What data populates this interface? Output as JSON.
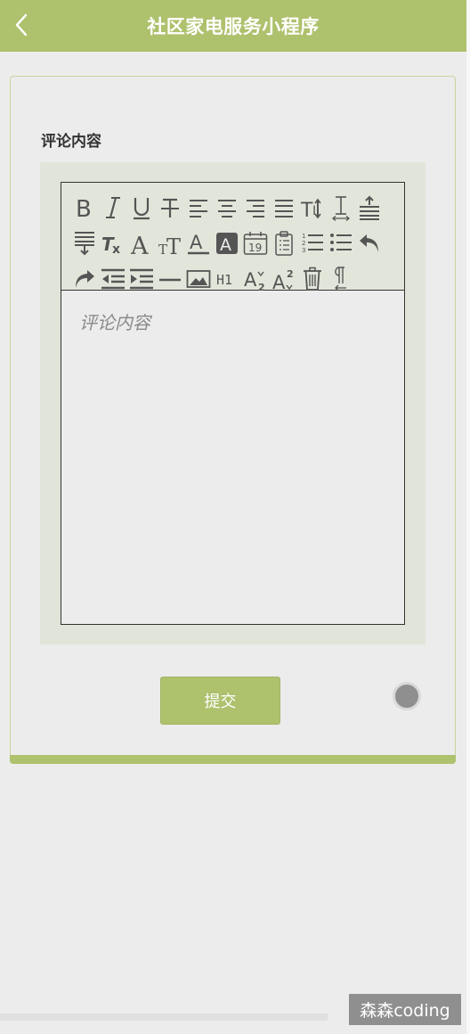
{
  "theme": {
    "accent": "#aec16d"
  },
  "nav": {
    "title": "社区家电服务小程序",
    "back_icon": "chevron-left-icon"
  },
  "form": {
    "field_label": "评论内容",
    "editor_placeholder": "评论内容",
    "submit_label": "提交"
  },
  "toolbar": {
    "tools": [
      {
        "name": "bold",
        "glyph": "B"
      },
      {
        "name": "italic",
        "glyph": "I"
      },
      {
        "name": "underline",
        "glyph": "U"
      },
      {
        "name": "strikethrough",
        "glyph": "T"
      },
      {
        "name": "align-left"
      },
      {
        "name": "align-center"
      },
      {
        "name": "align-right"
      },
      {
        "name": "align-justify"
      },
      {
        "name": "font-size",
        "glyph": "T↕"
      },
      {
        "name": "line-height",
        "glyph": "I"
      },
      {
        "name": "spacing-before"
      },
      {
        "name": "spacing-after"
      },
      {
        "name": "clear-format",
        "glyph": "Tx"
      },
      {
        "name": "font-family",
        "glyph": "A"
      },
      {
        "name": "font-size-adjust",
        "glyph": "тT"
      },
      {
        "name": "font-color",
        "glyph": "A"
      },
      {
        "name": "background-color",
        "glyph": "A"
      },
      {
        "name": "insert-date",
        "glyph": "19"
      },
      {
        "name": "checklist"
      },
      {
        "name": "ordered-list"
      },
      {
        "name": "bullet-list"
      },
      {
        "name": "undo"
      },
      {
        "name": "redo"
      },
      {
        "name": "outdent"
      },
      {
        "name": "indent"
      },
      {
        "name": "horizontal-rule"
      },
      {
        "name": "insert-image"
      },
      {
        "name": "heading",
        "glyph": "H1"
      },
      {
        "name": "subscript",
        "glyph": "A2"
      },
      {
        "name": "superscript",
        "glyph": "A2"
      },
      {
        "name": "delete"
      },
      {
        "name": "text-direction",
        "glyph": "¶"
      }
    ]
  },
  "watermark": {
    "text": "森森coding"
  }
}
